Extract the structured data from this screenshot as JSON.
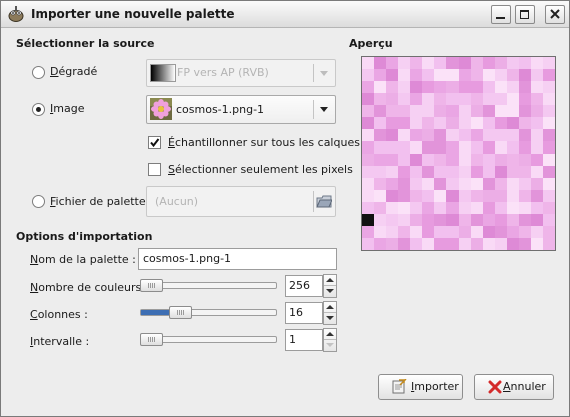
{
  "window": {
    "title": "Importer une nouvelle palette"
  },
  "source": {
    "heading": "Sélectionner la source",
    "gradient": {
      "label_initial": "D",
      "label_rest": "égradé",
      "value": "FP vers AP (RVB)",
      "selected": false
    },
    "image": {
      "label_initial": "I",
      "label_rest": "mage",
      "value": "cosmos-1.png-1",
      "selected": true
    },
    "sample_all_layers": {
      "label_initial": "É",
      "label_rest": "chantillonner sur tous les calques",
      "checked": true
    },
    "selected_pixels_only": {
      "label_initial": "S",
      "label_rest": "électionner seulement les pixels",
      "checked": false
    },
    "palette_file": {
      "label_initial": "F",
      "label_rest": "ichier de palettes",
      "value": "(Aucun)",
      "selected": false
    }
  },
  "options": {
    "heading": "Options d'importation",
    "palette_name": {
      "label_initial": "N",
      "label_rest": "om de la palette :",
      "value": "cosmos-1.png-1"
    },
    "num_colors": {
      "label_initial": "N",
      "label_rest": "ombre de couleurs :",
      "value": "256",
      "level": 0.0
    },
    "columns": {
      "label_initial": "C",
      "label_rest": "olonnes :",
      "value": "16",
      "level": 0.25
    },
    "interval": {
      "label_initial": "I",
      "label_rest": "ntervalle :",
      "value": "1",
      "level": 0.0
    }
  },
  "preview": {
    "heading": "Aperçu",
    "palette": [
      "#f2c0ef",
      "#eaa6e4",
      "#f6d0f3",
      "#e79bdf",
      "#efb5e9",
      "#f9daf6",
      "#de8ad6",
      "#f4c8f1",
      "#ecaee6",
      "#e294da",
      "#fbe2f8"
    ],
    "dark_color": "#111111"
  },
  "buttons": {
    "import_label": "Importer",
    "import_initial": "I",
    "import_rest": "mporter",
    "cancel_initial": "A",
    "cancel_rest": "nnuler"
  },
  "colors": {
    "accent": "#3d6eb3",
    "cancel_red": "#d42b2b"
  }
}
